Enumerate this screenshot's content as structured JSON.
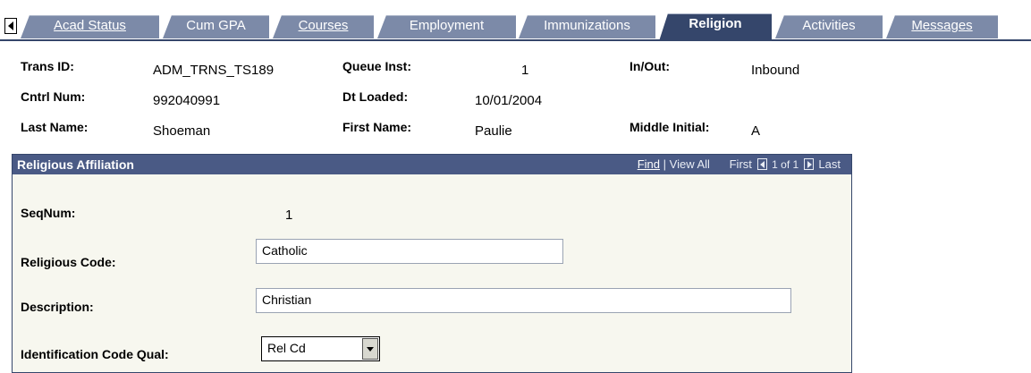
{
  "tabs": [
    {
      "label": "Acad Status",
      "access": "A",
      "active": false
    },
    {
      "label": "Cum GPA",
      "access": "G",
      "active": false
    },
    {
      "label": "Courses",
      "access": "C",
      "active": false
    },
    {
      "label": "Employment",
      "access": "y",
      "active": false
    },
    {
      "label": "Immunizations",
      "access": "z",
      "active": false
    },
    {
      "label": "Religion",
      "access": "",
      "active": true
    },
    {
      "label": "Activities",
      "access": "v",
      "active": false
    },
    {
      "label": "Messages",
      "access": "M",
      "active": false
    }
  ],
  "header": {
    "trans_id_label": "Trans ID:",
    "trans_id": "ADM_TRNS_TS189",
    "queue_inst_label": "Queue Inst:",
    "queue_inst": "1",
    "in_out_label": "In/Out:",
    "in_out": "Inbound",
    "cntrl_num_label": "Cntrl Num:",
    "cntrl_num": "992040991",
    "dt_loaded_label": "Dt Loaded:",
    "dt_loaded": "10/01/2004",
    "last_name_label": "Last Name:",
    "last_name": "Shoeman",
    "first_name_label": "First Name:",
    "first_name": "Paulie",
    "middle_initial_label": "Middle Initial:",
    "middle_initial": "A"
  },
  "panel": {
    "title": "Religious Affiliation",
    "find": "Find",
    "view_all": "View All",
    "first": "First",
    "counter": "1 of 1",
    "last": "Last",
    "seqnum_label": "SeqNum:",
    "seqnum": "1",
    "religious_code_label": "Religious Code:",
    "religious_code": "Catholic",
    "description_label": "Description:",
    "description": "Christian",
    "id_code_qual_label": "Identification Code Qual:",
    "id_code_qual": "Rel Cd"
  },
  "colors": {
    "tab_inactive": "#7c8aa8",
    "tab_active": "#35466b",
    "panel_header": "#4a5a85",
    "panel_bg": "#f7f7ef"
  }
}
